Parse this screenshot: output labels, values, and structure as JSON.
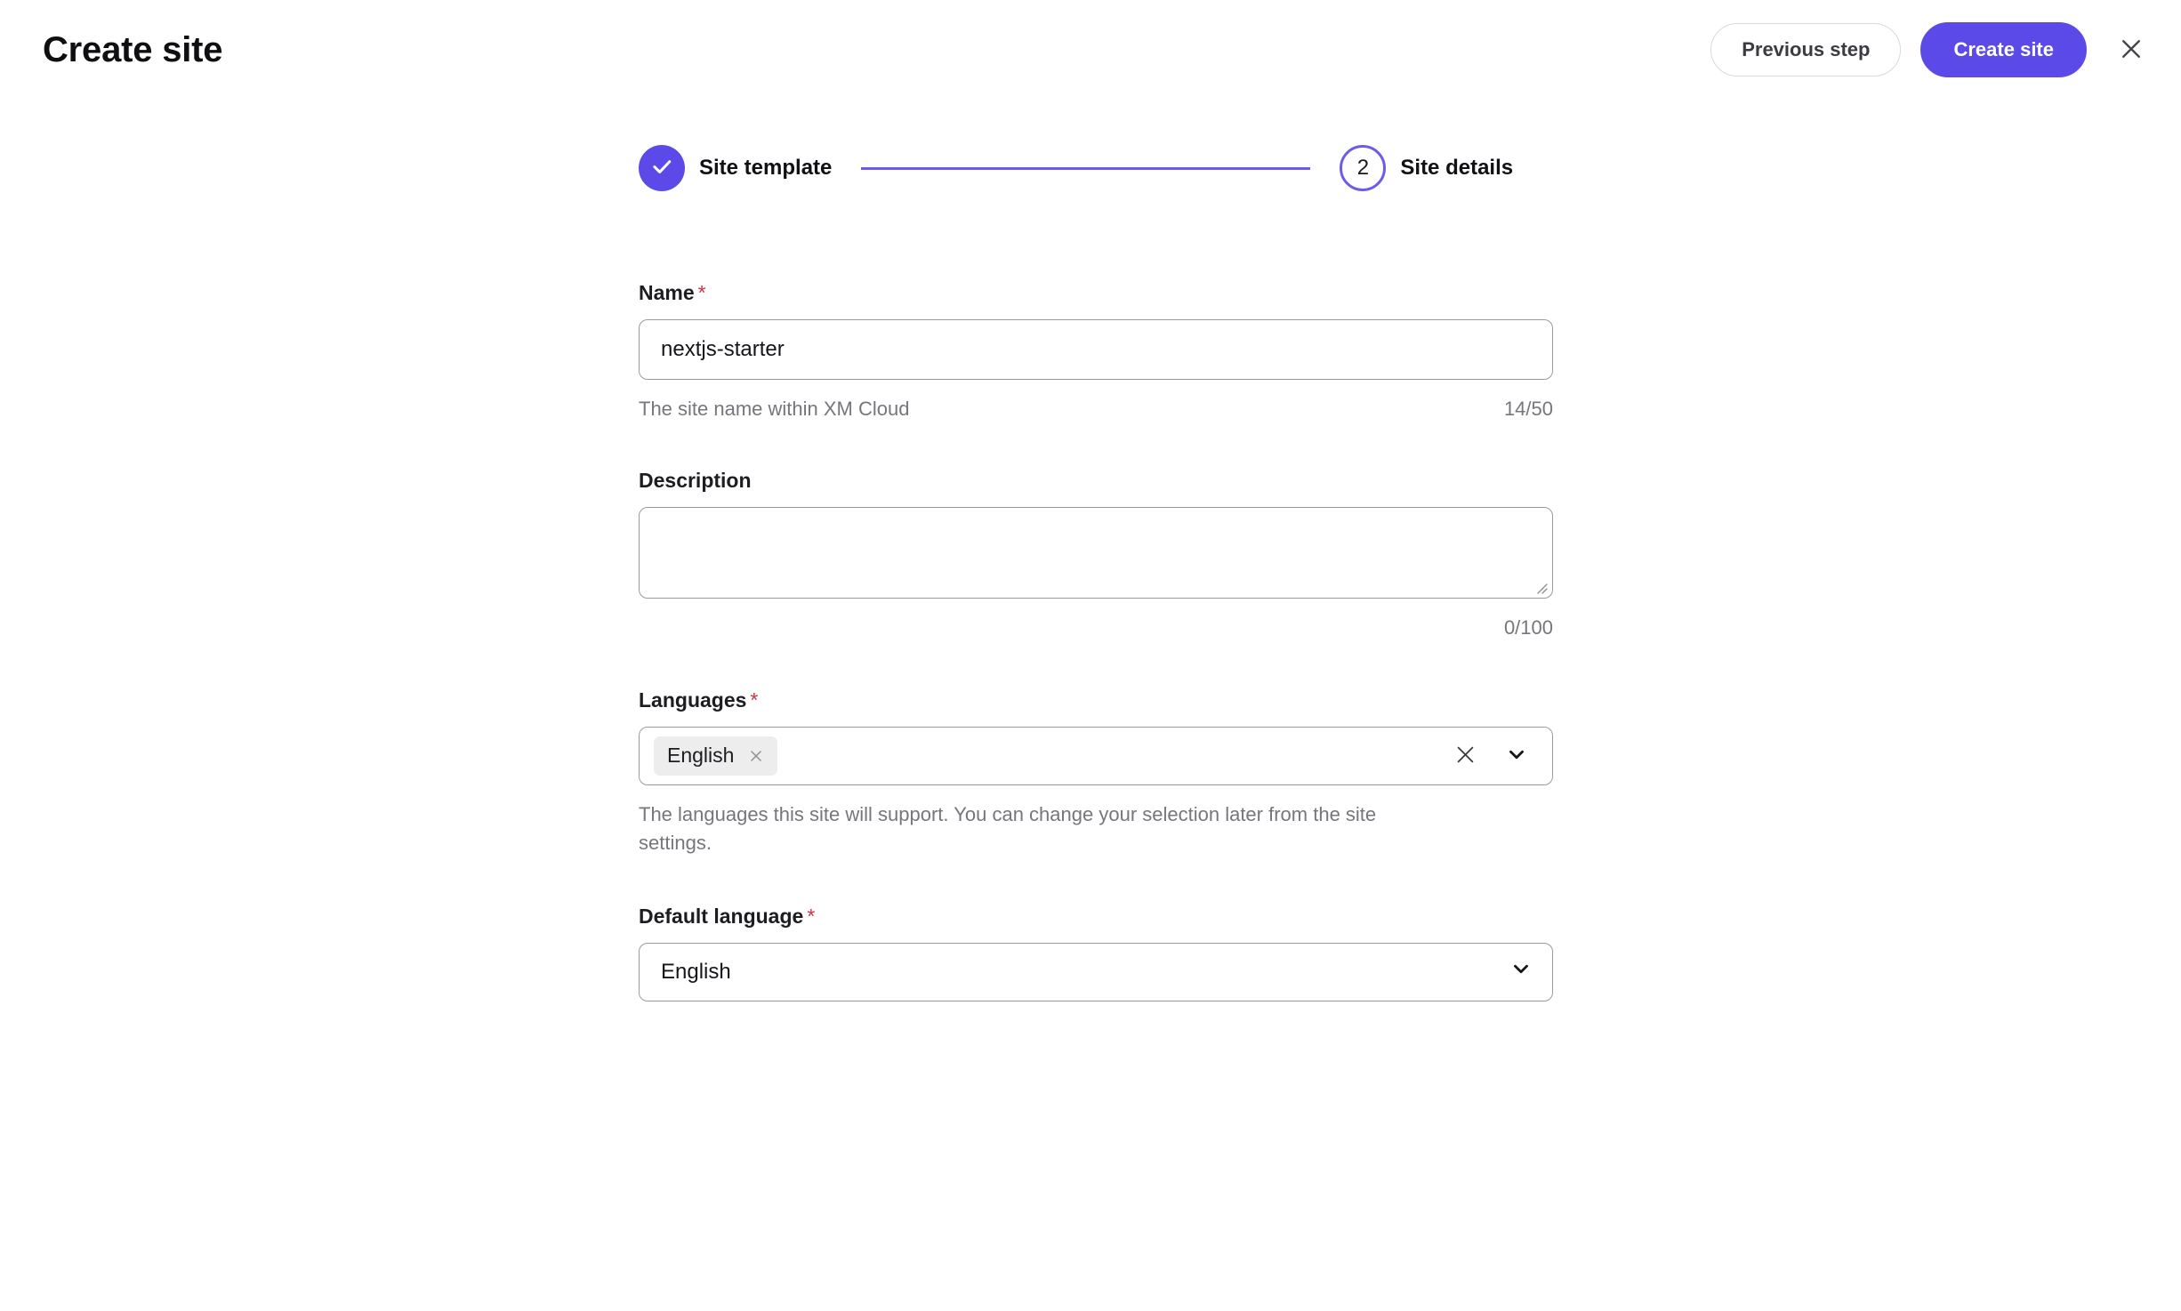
{
  "header": {
    "title": "Create site",
    "previous_label": "Previous step",
    "create_label": "Create site",
    "close_icon": "close-icon"
  },
  "stepper": {
    "steps": [
      {
        "label": "Site template",
        "state": "completed",
        "icon": "check-icon"
      },
      {
        "label": "Site details",
        "state": "active",
        "number": "2"
      }
    ]
  },
  "form": {
    "name": {
      "label": "Name",
      "required_marker": "*",
      "value": "nextjs-starter",
      "placeholder": "",
      "helper": "The site name within XM Cloud",
      "counter": "14/50"
    },
    "description": {
      "label": "Description",
      "value": "",
      "placeholder": "",
      "counter": "0/100"
    },
    "languages": {
      "label": "Languages",
      "required_marker": "*",
      "chips": [
        {
          "label": "English"
        }
      ],
      "helper": "The languages this site will support. You can change your selection later from the site settings.",
      "clear_icon": "clear-icon",
      "chevron_icon": "chevron-down-icon"
    },
    "default_language": {
      "label": "Default language",
      "required_marker": "*",
      "value": "English",
      "chevron_icon": "chevron-down-icon"
    }
  },
  "colors": {
    "accent": "#5b4ae8",
    "accent_line": "#6c5ce7",
    "required": "#cc3344",
    "helper_text": "#76767c",
    "border": "#9b9b9f",
    "chip_bg": "#ededee"
  }
}
